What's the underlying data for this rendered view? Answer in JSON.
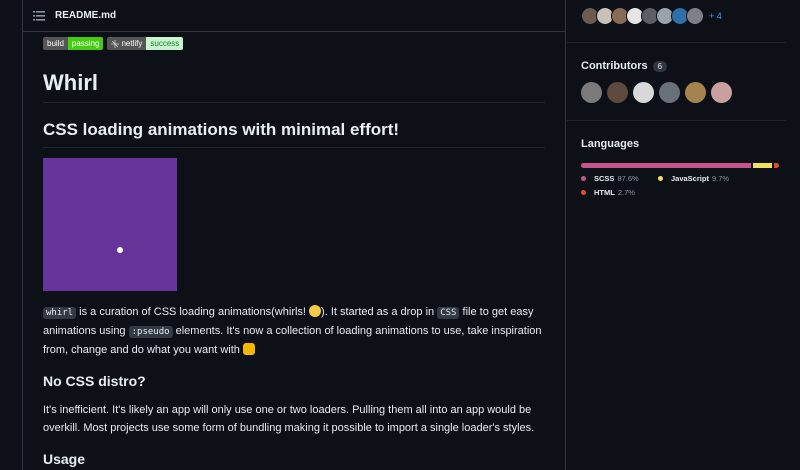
{
  "readme": {
    "filename": "README.md",
    "badges": [
      {
        "label": "build",
        "value": "passing"
      },
      {
        "label": "netlify",
        "value": "success"
      }
    ],
    "title": "Whirl",
    "subtitle": "CSS loading animations with minimal effort!",
    "intro": {
      "code1": "whirl",
      "text1": " is a curation of CSS loading animations(whirls! ",
      "text2": "). It started as a drop in ",
      "code2": "CSS",
      "text3": " file to get easy animations using ",
      "code3": ":pseudo",
      "text4": " elements. It's now a collection of loading animations to use, take inspiration from, change and do what you want with "
    },
    "section_no_css": {
      "heading": "No CSS distro?",
      "body": "It's inefficient. It's likely an app will only use one or two loaders. Pulling them all into an app would be overkill. Most projects use some form of bundling making it possible to import a single loader's styles."
    },
    "section_usage": {
      "heading": "Usage"
    },
    "colors": {
      "demo_bg": "#663399"
    }
  },
  "sidebar": {
    "watchers_more": "+ 4",
    "contributors": {
      "heading": "Contributors",
      "count": "6"
    },
    "languages": {
      "heading": "Languages",
      "items": [
        {
          "name": "SCSS",
          "percent": "87.6%",
          "color": "#c6538c",
          "value": 87.6
        },
        {
          "name": "JavaScript",
          "percent": "9.7%",
          "color": "#f1e05a",
          "value": 9.7
        },
        {
          "name": "HTML",
          "percent": "2.7%",
          "color": "#e34c26",
          "value": 2.7
        }
      ]
    }
  }
}
